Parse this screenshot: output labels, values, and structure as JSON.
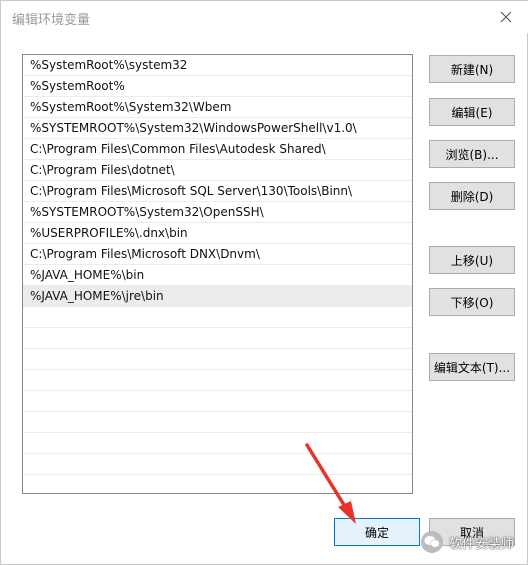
{
  "window": {
    "title": "编辑环境变量"
  },
  "path_list": [
    {
      "value": "%SystemRoot%\\system32"
    },
    {
      "value": "%SystemRoot%"
    },
    {
      "value": "%SystemRoot%\\System32\\Wbem"
    },
    {
      "value": "%SYSTEMROOT%\\System32\\WindowsPowerShell\\v1.0\\"
    },
    {
      "value": "C:\\Program Files\\Common Files\\Autodesk Shared\\"
    },
    {
      "value": "C:\\Program Files\\dotnet\\"
    },
    {
      "value": "C:\\Program Files\\Microsoft SQL Server\\130\\Tools\\Binn\\"
    },
    {
      "value": "%SYSTEMROOT%\\System32\\OpenSSH\\"
    },
    {
      "value": "%USERPROFILE%\\.dnx\\bin"
    },
    {
      "value": "C:\\Program Files\\Microsoft DNX\\Dnvm\\"
    },
    {
      "value": "%JAVA_HOME%\\bin"
    },
    {
      "value": "%JAVA_HOME%\\jre\\bin"
    }
  ],
  "buttons": {
    "new": "新建(N)",
    "edit": "编辑(E)",
    "browse": "浏览(B)...",
    "delete": "删除(D)",
    "move_up": "上移(U)",
    "move_down": "下移(O)",
    "edit_text": "编辑文本(T)...",
    "ok": "确定",
    "cancel": "取消"
  },
  "watermark": {
    "text": "软件安装师"
  },
  "colors": {
    "selected_row": "#ececec",
    "annotation_arrow": "#e8332a",
    "ok_button_border": "#0078d7"
  }
}
